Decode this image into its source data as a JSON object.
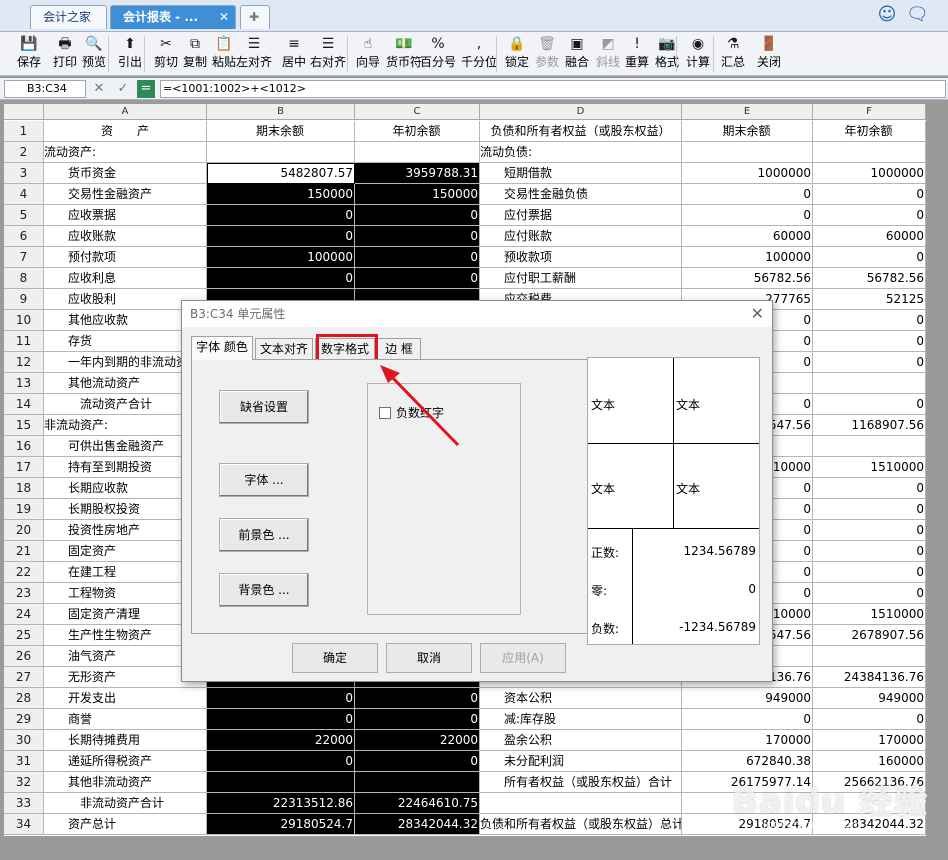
{
  "tabs": [
    {
      "label": "会计之家"
    },
    {
      "label": "会计报表 - ...",
      "close": "✕"
    },
    {
      "label": "✚"
    }
  ],
  "toolbar": [
    {
      "label": "保存",
      "icon": "💾",
      "name": "save-button"
    },
    {
      "label": "打印",
      "icon": "🖶",
      "name": "print-button"
    },
    {
      "label": "预览",
      "icon": "🔍",
      "name": "preview-button"
    },
    {
      "label": "引出",
      "icon": "⬆",
      "name": "export-button"
    },
    {
      "label": "剪切",
      "icon": "✂",
      "name": "cut-button"
    },
    {
      "label": "复制",
      "icon": "⧉",
      "name": "copy-button"
    },
    {
      "label": "粘贴",
      "icon": "📋",
      "name": "paste-button"
    },
    {
      "label": "左对齐",
      "icon": "☰",
      "name": "align-left-button"
    },
    {
      "label": "居中",
      "icon": "≡",
      "name": "align-center-button"
    },
    {
      "label": "右对齐",
      "icon": "☰",
      "name": "align-right-button"
    },
    {
      "label": "向导",
      "icon": "☝",
      "name": "wizard-button"
    },
    {
      "label": "货币符",
      "icon": "💵",
      "name": "currency-button"
    },
    {
      "label": "百分号",
      "icon": "%",
      "name": "percent-button"
    },
    {
      "label": "千分位",
      "icon": ",",
      "name": "thousands-button"
    },
    {
      "label": "锁定",
      "icon": "🔒",
      "name": "lock-button"
    },
    {
      "label": "参数",
      "icon": "🗑",
      "name": "params-button",
      "disabled": true
    },
    {
      "label": "融合",
      "icon": "▣",
      "name": "merge-button"
    },
    {
      "label": "斜线",
      "icon": "◩",
      "name": "diagonal-button",
      "disabled": true
    },
    {
      "label": "重算",
      "icon": "!",
      "name": "recalc-button"
    },
    {
      "label": "格式",
      "icon": "📷",
      "name": "format-button"
    },
    {
      "label": "计算",
      "icon": "◉",
      "name": "calculate-button"
    },
    {
      "label": "汇总",
      "icon": "⚗",
      "name": "summary-button"
    },
    {
      "label": "关闭",
      "icon": "🚪",
      "name": "close-button"
    }
  ],
  "formula_bar": {
    "cell_ref": "B3:C34",
    "formula": "=<1001:1002>+<1012>"
  },
  "columns": [
    "A",
    "B",
    "C",
    "D",
    "E",
    "F"
  ],
  "rows": [
    {
      "n": "1",
      "a": "资　　产",
      "b": "期末余额",
      "c": "年初余额",
      "d": "负债和所有者权益（或股东权益）",
      "e": "期末余额",
      "f": "年初余额"
    },
    {
      "n": "2",
      "a": "流动资产:",
      "b": "",
      "c": "",
      "d": "流动负债:",
      "e": "",
      "f": ""
    },
    {
      "n": "3",
      "a": "　　货币资金",
      "b": "5482807.57",
      "c": "3959788.31",
      "d": "　　短期借款",
      "e": "1000000",
      "f": "1000000"
    },
    {
      "n": "4",
      "a": "　　交易性金融资产",
      "b": "150000",
      "c": "150000",
      "d": "　　交易性金融负债",
      "e": "0",
      "f": "0"
    },
    {
      "n": "5",
      "a": "　　应收票据",
      "b": "0",
      "c": "0",
      "d": "　　应付票据",
      "e": "0",
      "f": "0"
    },
    {
      "n": "6",
      "a": "　　应收账款",
      "b": "0",
      "c": "0",
      "d": "　　应付账款",
      "e": "60000",
      "f": "60000"
    },
    {
      "n": "7",
      "a": "　　预付款项",
      "b": "100000",
      "c": "0",
      "d": "　　预收款项",
      "e": "100000",
      "f": "0"
    },
    {
      "n": "8",
      "a": "　　应收利息",
      "b": "0",
      "c": "0",
      "d": "　　应付职工薪酬",
      "e": "56782.56",
      "f": "56782.56"
    },
    {
      "n": "9",
      "a": "　　应收股利",
      "b": "",
      "c": "",
      "d": "　　应交税费",
      "e": "277765",
      "f": "52125"
    },
    {
      "n": "10",
      "a": "　　其他应收款",
      "b": "",
      "c": "",
      "d": "",
      "e": "0",
      "f": "0"
    },
    {
      "n": "11",
      "a": "　　存货",
      "b": "",
      "c": "",
      "d": "",
      "e": "0",
      "f": "0"
    },
    {
      "n": "12",
      "a": "　　一年内到期的非流动资产",
      "b": "",
      "c": "",
      "d": "",
      "e": "0",
      "f": "0"
    },
    {
      "n": "13",
      "a": "　　其他流动资产",
      "b": "",
      "c": "",
      "d": "",
      "e": "",
      "f": ""
    },
    {
      "n": "14",
      "a": "　　　流动资产合计",
      "b": "",
      "c": "",
      "d": "",
      "e": "0",
      "f": "0"
    },
    {
      "n": "15",
      "a": "非流动资产:",
      "b": "",
      "c": "",
      "d": "",
      "e": "547.56",
      "f": "1168907.56"
    },
    {
      "n": "16",
      "a": "　　可供出售金融资产",
      "b": "",
      "c": "",
      "d": "",
      "e": "",
      "f": ""
    },
    {
      "n": "17",
      "a": "　　持有至到期投资",
      "b": "",
      "c": "",
      "d": "",
      "e": "510000",
      "f": "1510000"
    },
    {
      "n": "18",
      "a": "　　长期应收款",
      "b": "",
      "c": "",
      "d": "",
      "e": "0",
      "f": "0"
    },
    {
      "n": "19",
      "a": "　　长期股权投资",
      "b": "",
      "c": "",
      "d": "",
      "e": "0",
      "f": "0"
    },
    {
      "n": "20",
      "a": "　　投资性房地产",
      "b": "",
      "c": "",
      "d": "",
      "e": "0",
      "f": "0"
    },
    {
      "n": "21",
      "a": "　　固定资产",
      "b": "",
      "c": "",
      "d": "",
      "e": "0",
      "f": "0"
    },
    {
      "n": "22",
      "a": "　　在建工程",
      "b": "",
      "c": "",
      "d": "",
      "e": "0",
      "f": "0"
    },
    {
      "n": "23",
      "a": "　　工程物资",
      "b": "",
      "c": "",
      "d": "",
      "e": "0",
      "f": "0"
    },
    {
      "n": "24",
      "a": "　　固定资产清理",
      "b": "",
      "c": "",
      "d": "",
      "e": "510000",
      "f": "1510000"
    },
    {
      "n": "25",
      "a": "　　生产性生物资产",
      "b": "",
      "c": "",
      "d": "",
      "e": "547.56",
      "f": "2678907.56"
    },
    {
      "n": "26",
      "a": "　　油气资产",
      "b": "",
      "c": "",
      "d": "",
      "e": "",
      "f": ""
    },
    {
      "n": "27",
      "a": "　　无形资产",
      "b": "",
      "c": "",
      "d": "",
      "e": "136.76",
      "f": "24384136.76"
    },
    {
      "n": "28",
      "a": "　　开发支出",
      "b": "0",
      "c": "0",
      "d": "　　资本公积",
      "e": "949000",
      "f": "949000"
    },
    {
      "n": "29",
      "a": "　　商誉",
      "b": "0",
      "c": "0",
      "d": "　　减:库存股",
      "e": "0",
      "f": "0"
    },
    {
      "n": "30",
      "a": "　　长期待摊费用",
      "b": "22000",
      "c": "22000",
      "d": "　　盈余公积",
      "e": "170000",
      "f": "170000"
    },
    {
      "n": "31",
      "a": "　　递延所得税资产",
      "b": "0",
      "c": "0",
      "d": "　　未分配利润",
      "e": "672840.38",
      "f": "160000"
    },
    {
      "n": "32",
      "a": "　　其他非流动资产",
      "b": "",
      "c": "",
      "d": "　　所有者权益（或股东权益）合计",
      "e": "26175977.14",
      "f": "25662136.76"
    },
    {
      "n": "33",
      "a": "　　　非流动资产合计",
      "b": "22313512.86",
      "c": "22464610.75",
      "d": "",
      "e": "",
      "f": ""
    },
    {
      "n": "34",
      "a": "　　资产总计",
      "b": "29180524.7",
      "c": "28342044.32",
      "d": "负债和所有者权益（或股东权益）总计",
      "e": "29180524.7",
      "f": "28342044.32"
    }
  ],
  "dialog": {
    "title": "B3:C34 单元属性",
    "tabs": [
      "字体 颜色",
      "文本对齐",
      "数字格式",
      "边 框"
    ],
    "buttons": [
      "缺省设置",
      "字体 ...",
      "前景色 ...",
      "背景色 ..."
    ],
    "checkbox_label": "负数红字",
    "preview": {
      "cells": [
        "文本",
        "文本",
        "文本",
        "文本"
      ],
      "positive_label": "正数:",
      "positive_value": "1234.56789",
      "zero_label": "零:",
      "zero_value": "0",
      "negative_label": "负数:",
      "negative_value": "-1234.56789"
    },
    "ok": "确定",
    "cancel": "取消",
    "apply": "应用(A)"
  },
  "watermark": {
    "text": "Baidu 经验",
    "sub": "jingyan.baidu.com"
  },
  "colors": {
    "selection": "#000000",
    "highlight": "#e0141e",
    "active_tab": "#3f8fd7"
  }
}
